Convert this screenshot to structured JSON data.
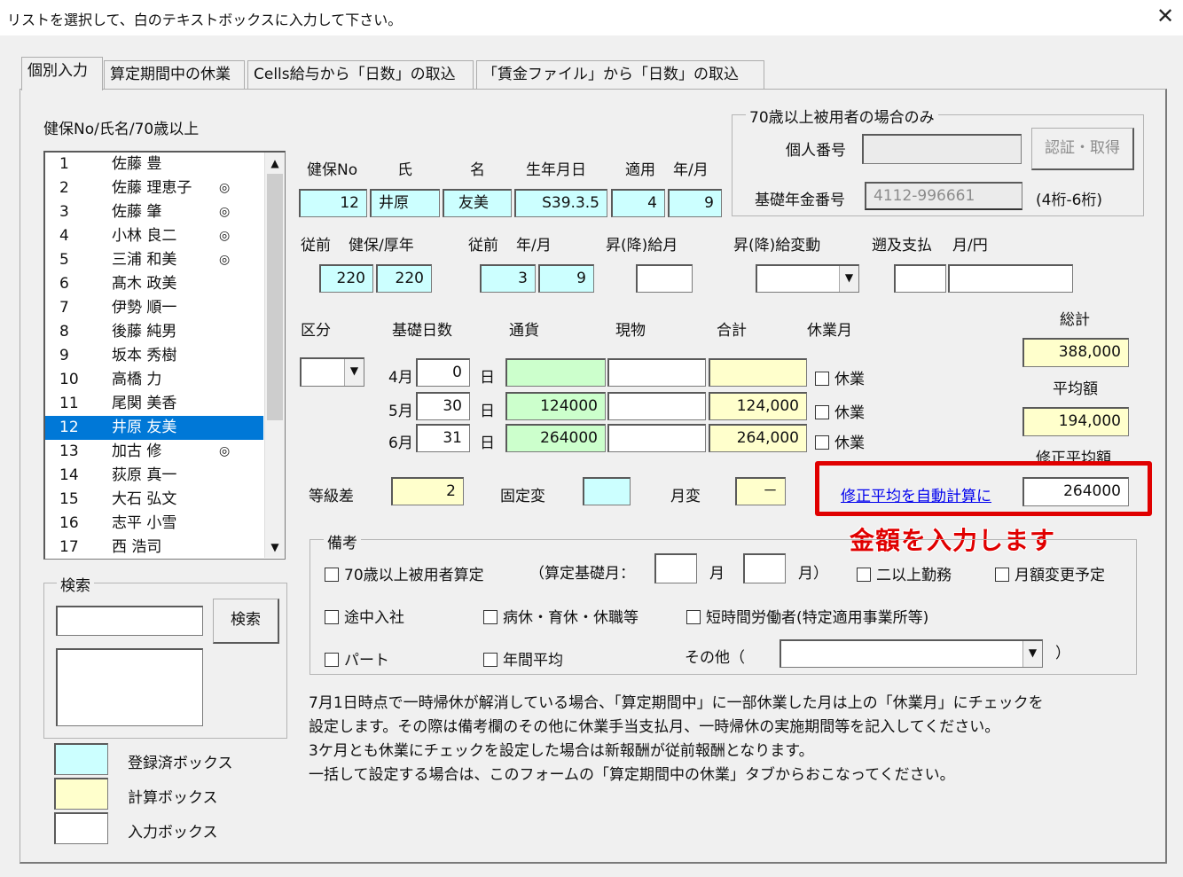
{
  "window": {
    "title": "リストを選択して、白のテキストボックスに入力して下さい。",
    "close": "✕"
  },
  "tabs": [
    "個別入力",
    "算定期間中の休業",
    "Cells給与から「日数」の取込",
    "「賃金ファイル」から「日数」の取込"
  ],
  "list": {
    "header": "健保No/氏名/70歳以上",
    "selected_index": 11,
    "items": [
      {
        "no": "1",
        "name": "佐藤 豊",
        "mark": ""
      },
      {
        "no": "2",
        "name": "佐藤 理恵子",
        "mark": "◎"
      },
      {
        "no": "3",
        "name": "佐藤 肇",
        "mark": "◎"
      },
      {
        "no": "4",
        "name": "小林 良二",
        "mark": "◎"
      },
      {
        "no": "5",
        "name": "三浦 和美",
        "mark": "◎"
      },
      {
        "no": "6",
        "name": "髙木 政美",
        "mark": ""
      },
      {
        "no": "7",
        "name": "伊勢 順一",
        "mark": ""
      },
      {
        "no": "8",
        "name": "後藤 純男",
        "mark": ""
      },
      {
        "no": "9",
        "name": "坂本 秀樹",
        "mark": ""
      },
      {
        "no": "10",
        "name": "高橋 力",
        "mark": ""
      },
      {
        "no": "11",
        "name": "尾関 美香",
        "mark": ""
      },
      {
        "no": "12",
        "name": "井原 友美",
        "mark": ""
      },
      {
        "no": "13",
        "name": "加古 修",
        "mark": "◎"
      },
      {
        "no": "14",
        "name": "荻原 真一",
        "mark": ""
      },
      {
        "no": "15",
        "name": "大石 弘文",
        "mark": ""
      },
      {
        "no": "16",
        "name": "志平 小雪",
        "mark": ""
      },
      {
        "no": "17",
        "name": "西 浩司",
        "mark": ""
      }
    ]
  },
  "search": {
    "group": "検索",
    "button": "検索",
    "input": "",
    "result": ""
  },
  "legend": {
    "registered": "登録済ボックス",
    "calc": "計算ボックス",
    "input": "入力ボックス"
  },
  "over70": {
    "group": "70歳以上被用者の場合のみ",
    "kojin_label": "個人番号",
    "kojin_value": "",
    "auth_button": "認証・取得",
    "kiso_label": "基礎年金番号",
    "kiso_value": "4112-996661",
    "kiso_note": "(4桁-6桁)"
  },
  "header": {
    "labels": {
      "kenpo_no": "健保No",
      "shi": "氏",
      "mei": "名",
      "birth": "生年月日",
      "tekiyo": "適用",
      "nengetsu": "年/月"
    },
    "values": {
      "kenpo_no": "12",
      "shi": "井原",
      "mei": "友美",
      "birth": "S39.3.5",
      "tekiyo_y": "4",
      "tekiyo_m": "9"
    }
  },
  "prev": {
    "labels": {
      "juzen1": "従前",
      "hoken": "健保/厚年",
      "juzen2": "従前",
      "nengetsu": "年/月",
      "shokyu": "昇(降)給月",
      "hendo": "昇(降)給変動",
      "sokyu": "遡及支払",
      "tsukien": "月/円"
    },
    "values": {
      "kenpo": "220",
      "kosei": "220",
      "year": "3",
      "month": "9",
      "shokyu": "",
      "hendo": "",
      "sokyu_month": "",
      "sokyu_yen": ""
    }
  },
  "table": {
    "headers": {
      "kubun": "区分",
      "kiso": "基礎日数",
      "tsuka": "通貨",
      "genbutsu": "現物",
      "gokei": "合計",
      "kyugyo": "休業月"
    },
    "kubun_value": "",
    "day_unit": "日",
    "kyugyo_label": "休業",
    "rows": [
      {
        "month": "4月",
        "days": "0",
        "tsuka": "",
        "genbutsu": "",
        "gokei": ""
      },
      {
        "month": "5月",
        "days": "30",
        "tsuka": "124000",
        "genbutsu": "",
        "gokei": "124,000"
      },
      {
        "month": "6月",
        "days": "31",
        "tsuka": "264000",
        "genbutsu": "",
        "gokei": "264,000"
      }
    ]
  },
  "summary": {
    "total_label": "総計",
    "total": "388,000",
    "avg_label": "平均額",
    "avg": "194,000",
    "mod_label": "修正平均額",
    "mod": "264000",
    "auto_link": "修正平均を自動計算に"
  },
  "grade": {
    "diff_label": "等級差",
    "diff": "2",
    "kotei_label": "固定変",
    "kotei": "",
    "getsuhen_label": "月変",
    "getsuhen": "－"
  },
  "annotation": "金額を入力します",
  "biko": {
    "group": "備考",
    "over70": "70歳以上被用者算定",
    "santei_open": "（算定基礎月：",
    "month1": "",
    "tsuki1": "月",
    "month2": "",
    "tsuki2": "月）",
    "nijo": "二以上勤務",
    "getsugaku": "月額変更予定",
    "tochu": "途中入社",
    "byokyu": "病休・育休・休職等",
    "tanjikan": "短時間労働者(特定適用事業所等)",
    "part": "パート",
    "nenkan": "年間平均",
    "sonota": "その他（",
    "sonota_value": "",
    "close_paren": "）"
  },
  "notes": [
    "7月1日時点で一時帰休が解消している場合、「算定期間中」に一部休業した月は上の「休業月」にチェックを",
    "設定します。その際は備考欄のその他に休業手当支払月、一時帰休の実施期間等を記入してください。",
    "3ケ月とも休業にチェックを設定した場合は新報酬が従前報酬となります。",
    "一括して設定する場合は、このフォームの「算定期間中の休業」タブからおこなってください。"
  ],
  "colors": {
    "registered": "#ccffff",
    "calc": "#ffffcc",
    "currency": "#ccffcc",
    "selection": "#0078d7",
    "annotation": "#e00000"
  }
}
